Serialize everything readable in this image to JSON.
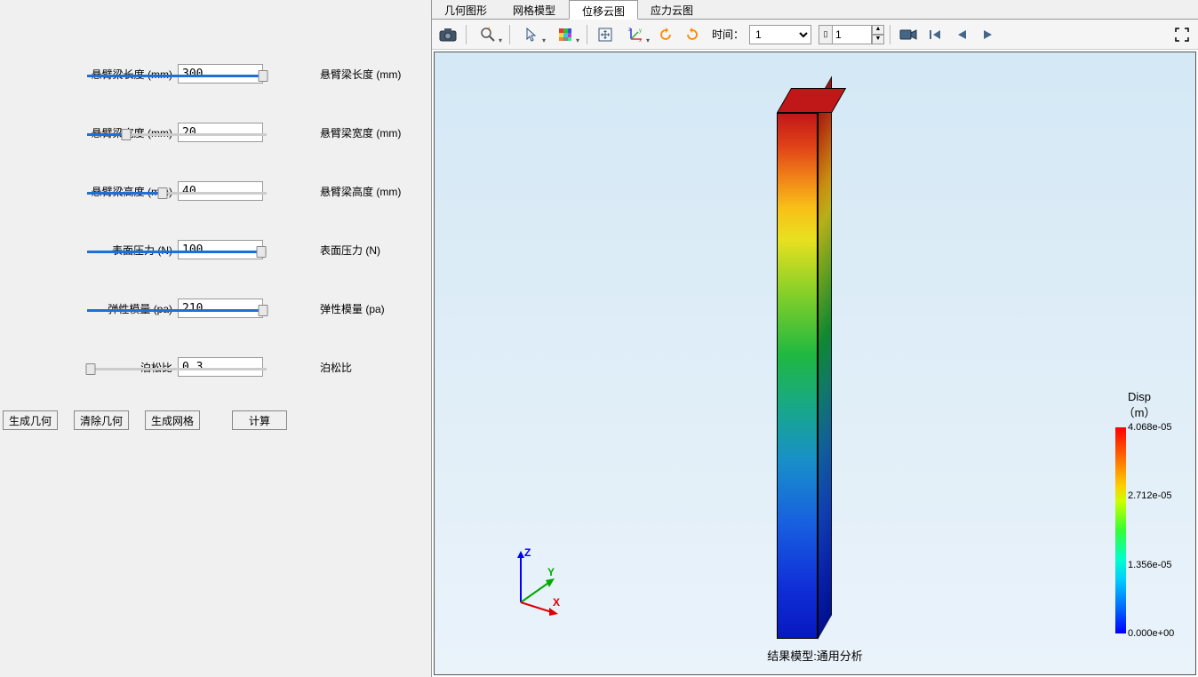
{
  "params": [
    {
      "label_left": "悬臂梁长度 (mm)",
      "value": "300",
      "label_right": "悬臂梁长度 (mm)",
      "slider_pct": 98
    },
    {
      "label_left": "悬臂梁宽度 (mm)",
      "value": "20",
      "label_right": "悬臂梁宽度 (mm)",
      "slider_pct": 22
    },
    {
      "label_left": "悬臂梁高度 (mm)",
      "value": "40",
      "label_right": "悬臂梁高度 (mm)",
      "slider_pct": 42
    },
    {
      "label_left": "表面压力 (N)",
      "value": "100",
      "label_right": "表面压力 (N)",
      "slider_pct": 97
    },
    {
      "label_left": "弹性模量 (pa)",
      "value": "210",
      "label_right": "弹性模量 (pa)",
      "slider_pct": 98
    },
    {
      "label_left": "泊松比",
      "value": "0.3",
      "label_right": "泊松比",
      "slider_pct": 2
    }
  ],
  "buttons": {
    "gen_geom": "生成几何",
    "clear_geom": "清除几何",
    "gen_mesh": "生成网格",
    "calc": "计算"
  },
  "tabs": [
    "几何图形",
    "网格模型",
    "位移云图",
    "应力云图"
  ],
  "active_tab": 2,
  "time_label": "时间：",
  "time_value": "1",
  "spin_value": "1",
  "caption": "结果模型:通用分析",
  "legend": {
    "title": "Disp",
    "unit": "（m）",
    "ticks": [
      {
        "pct": 0,
        "label": "4.068e-05"
      },
      {
        "pct": 33,
        "label": "2.712e-05"
      },
      {
        "pct": 67,
        "label": "1.356e-05"
      },
      {
        "pct": 100,
        "label": "0.000e+00"
      }
    ]
  },
  "axes": {
    "x": "X",
    "y": "Y",
    "z": "Z"
  }
}
